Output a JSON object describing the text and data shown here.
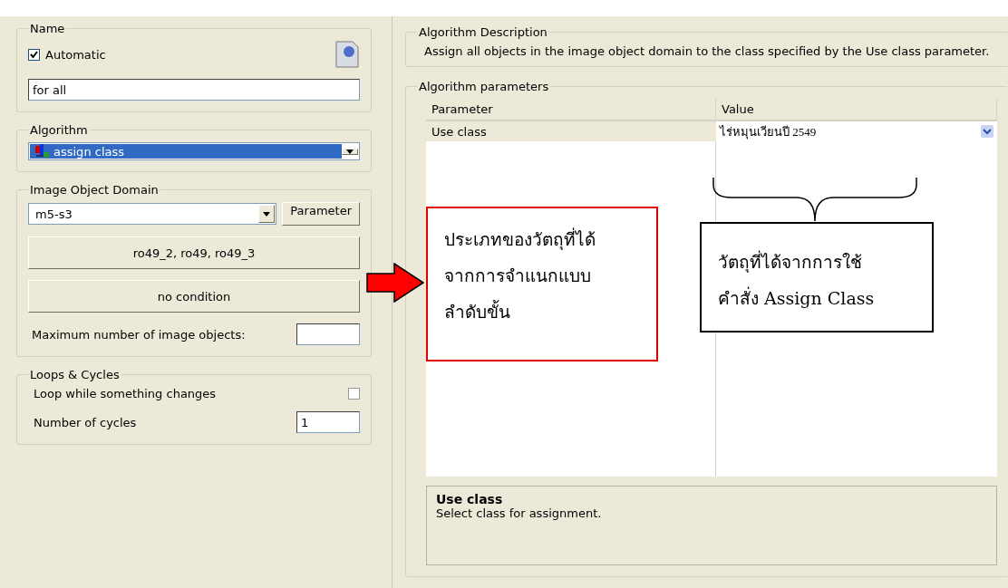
{
  "name_group": {
    "title": "Name",
    "automatic": {
      "label": "Automatic",
      "checked": true
    },
    "value": "for all"
  },
  "algorithm_group": {
    "title": "Algorithm",
    "value": "assign class"
  },
  "domain_group": {
    "title": "Image Object Domain",
    "level": "m5-s3",
    "parameter_button": "Parameter",
    "classes_button": "ro49_2, ro49, ro49_3",
    "condition_button": "no condition",
    "max_objects_label": "Maximum number of image objects:"
  },
  "loops_group": {
    "title": "Loops & Cycles",
    "loop_label": "Loop while something changes",
    "loop_checked": false,
    "cycles_label": "Number of cycles",
    "cycles_value": "1"
  },
  "description": {
    "title": "Algorithm Description",
    "text": "Assign all objects in the image object domain to the class specified by the Use class parameter."
  },
  "parameters": {
    "title": "Algorithm parameters",
    "columns": [
      "Parameter",
      "Value"
    ],
    "rows": [
      {
        "parameter": "Use class",
        "value": "ไร่หมุนเวียนปี 2549"
      }
    ],
    "info": {
      "title": "Use class",
      "text": "Select class for assignment."
    }
  },
  "annotations": [
    {
      "kind": "note",
      "lines": [
        "ประเภทของวัตถุที่ได้",
        "จากการจำแนกแบบ",
        "ลำดับขั้น"
      ]
    },
    {
      "kind": "callout",
      "lines": [
        "วัตถุที่ได้จากการใช้",
        "คำสั่ง Assign Class"
      ]
    }
  ]
}
